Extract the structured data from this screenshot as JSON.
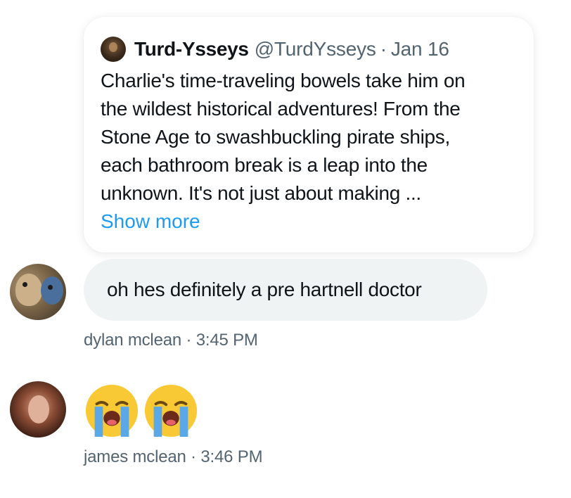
{
  "quote": {
    "name": "Turd-Ysseys",
    "handle": "@TurdYsseys",
    "separator": "·",
    "date": "Jan 16",
    "lines": [
      "Charlie's time-traveling bowels take him on",
      "the wildest historical adventures! From the",
      "Stone Age to swashbuckling pirate ships,",
      "each bathroom break is a leap into the",
      "unknown. It's not just about making ..."
    ],
    "show_more": "Show more"
  },
  "messages": [
    {
      "text": "oh hes definitely a pre hartnell doctor",
      "author": "dylan mclean",
      "time": "3:45 PM",
      "meta": "dylan mclean · 3:45 PM"
    },
    {
      "emoji": [
        "loudly-crying-face",
        "loudly-crying-face"
      ],
      "author": "james mclean",
      "time": "3:46 PM",
      "meta": "james mclean · 3:46 PM"
    }
  ],
  "colors": {
    "link": "#1d9bf0",
    "secondary_text": "#536471",
    "bubble_bg": "#eff3f4",
    "emoji_yellow": "#f9c935",
    "tear_blue": "#5aa9e6"
  }
}
